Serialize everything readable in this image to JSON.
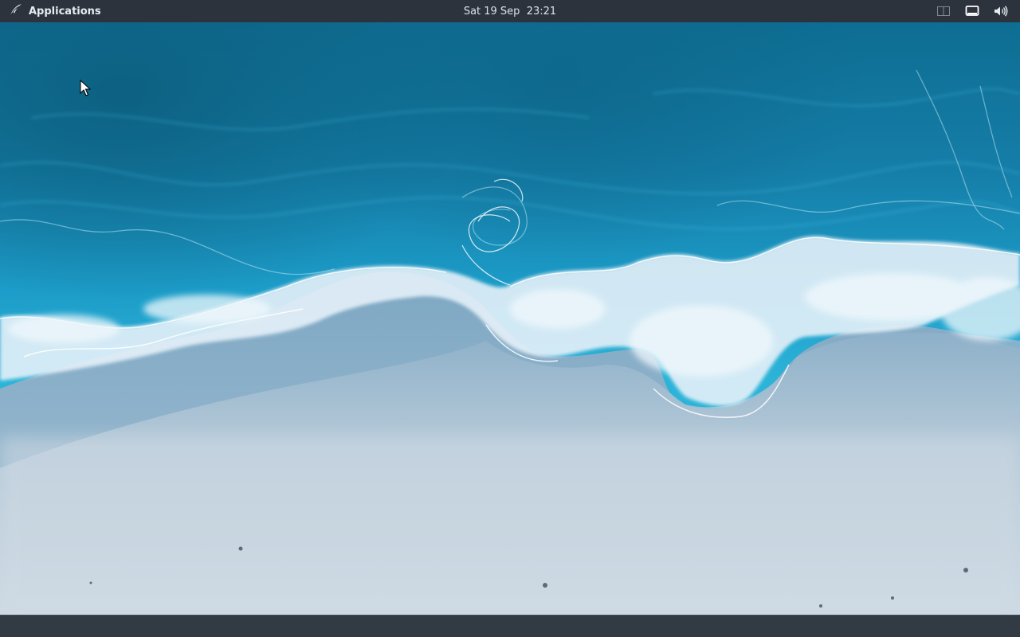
{
  "top_panel": {
    "applications_label": "Applications",
    "clock_text": "Sat 19 Sep  23:21",
    "tray_icons": [
      "workspace-icon",
      "display-icon",
      "volume-icon"
    ]
  },
  "wallpaper": {
    "subject": "aerial ocean waves on sand beach",
    "colors": {
      "deep": "#0f6f93",
      "mid": "#1893bf",
      "bright": "#2bb2da",
      "foam": "#e6f3fa",
      "wet_sand": "#8fb3cb",
      "sand": "#c9d6e0"
    }
  },
  "colors": {
    "panel": "#2c333d",
    "bottom_panel": "#323a44",
    "panel_text": "#dde3ea"
  }
}
